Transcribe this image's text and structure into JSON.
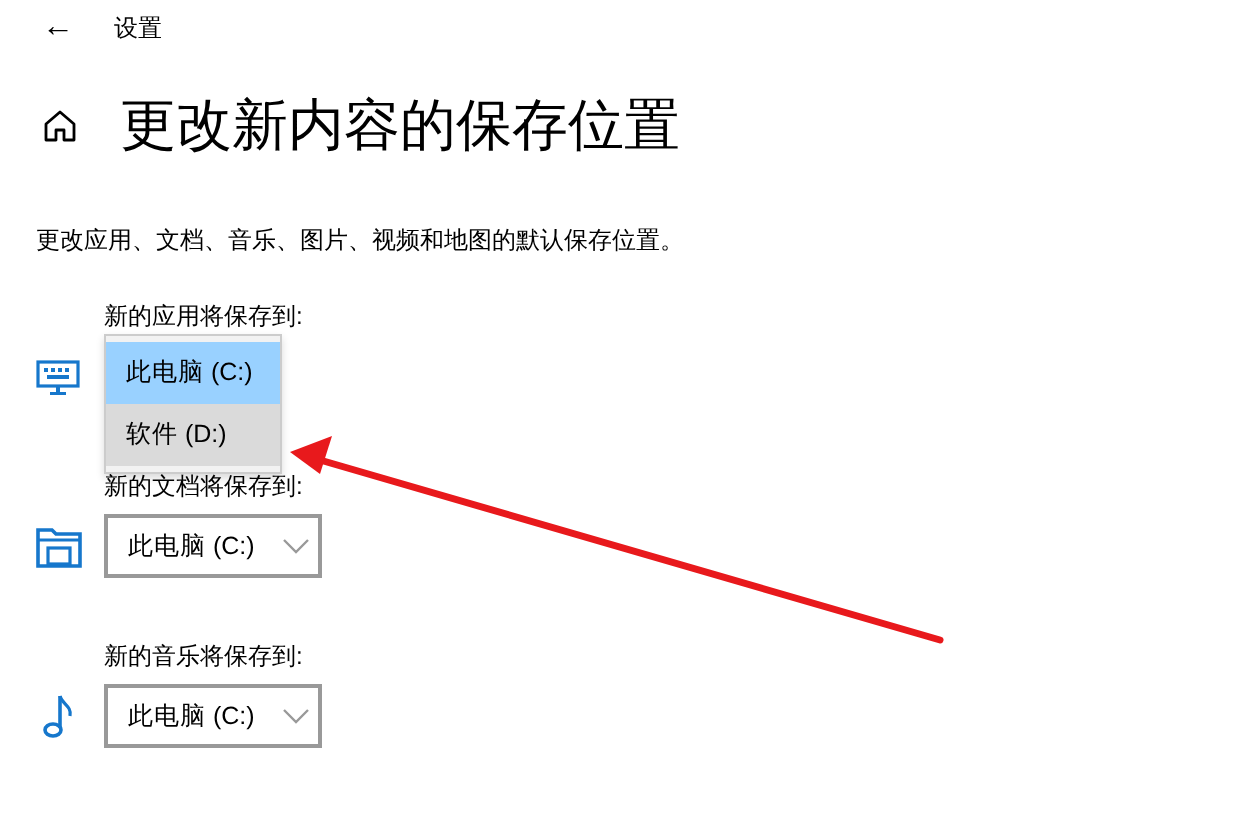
{
  "header": {
    "back": "←",
    "title": "设置"
  },
  "page": {
    "title": "更改新内容的保存位置",
    "description": "更改应用、文档、音乐、图片、视频和地图的默认保存位置。"
  },
  "sections": [
    {
      "kind": "apps",
      "label": "新的应用将保存到:",
      "expanded": true,
      "options": [
        {
          "label": "此电脑 (C:)",
          "selected": true,
          "hovered": false
        },
        {
          "label": "软件 (D:)",
          "selected": false,
          "hovered": true
        }
      ]
    },
    {
      "kind": "documents",
      "label": "新的文档将保存到:",
      "expanded": false,
      "value": "此电脑 (C:)"
    },
    {
      "kind": "music",
      "label": "新的音乐将保存到:",
      "expanded": false,
      "value": "此电脑 (C:)"
    }
  ]
}
